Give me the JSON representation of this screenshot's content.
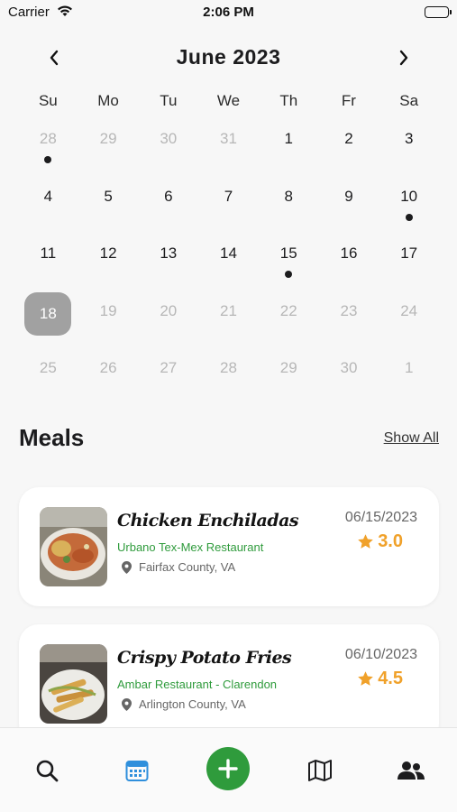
{
  "status_bar": {
    "carrier": "Carrier",
    "time": "2:06 PM"
  },
  "calendar": {
    "month_title": "June 2023",
    "weekdays": [
      "Su",
      "Mo",
      "Tu",
      "We",
      "Th",
      "Fr",
      "Sa"
    ],
    "weeks": [
      [
        {
          "d": "28",
          "m": true,
          "dot": true
        },
        {
          "d": "29",
          "m": true
        },
        {
          "d": "30",
          "m": true
        },
        {
          "d": "31",
          "m": true
        },
        {
          "d": "1"
        },
        {
          "d": "2"
        },
        {
          "d": "3"
        }
      ],
      [
        {
          "d": "4"
        },
        {
          "d": "5"
        },
        {
          "d": "6"
        },
        {
          "d": "7"
        },
        {
          "d": "8"
        },
        {
          "d": "9"
        },
        {
          "d": "10",
          "dot": true
        }
      ],
      [
        {
          "d": "11"
        },
        {
          "d": "12"
        },
        {
          "d": "13"
        },
        {
          "d": "14"
        },
        {
          "d": "15",
          "dot": true
        },
        {
          "d": "16"
        },
        {
          "d": "17"
        }
      ],
      [
        {
          "d": "18",
          "m": true,
          "sel": true
        },
        {
          "d": "19",
          "m": true
        },
        {
          "d": "20",
          "m": true
        },
        {
          "d": "21",
          "m": true
        },
        {
          "d": "22",
          "m": true
        },
        {
          "d": "23",
          "m": true
        },
        {
          "d": "24",
          "m": true
        }
      ],
      [
        {
          "d": "25",
          "m": true
        },
        {
          "d": "26",
          "m": true
        },
        {
          "d": "27",
          "m": true
        },
        {
          "d": "28",
          "m": true
        },
        {
          "d": "29",
          "m": true
        },
        {
          "d": "30",
          "m": true
        },
        {
          "d": "1",
          "m": true
        }
      ]
    ]
  },
  "meals": {
    "title": "Meals",
    "show_all": "Show All",
    "items": [
      {
        "name": "Chicken Enchiladas",
        "restaurant": "Urbano Tex-Mex Restaurant",
        "location": "Fairfax County, VA",
        "date": "06/15/2023",
        "rating": "3.0"
      },
      {
        "name": "Crispy Potato Fries",
        "restaurant": "Ambar Restaurant - Clarendon",
        "location": "Arlington County, VA",
        "date": "06/10/2023",
        "rating": "4.5"
      }
    ]
  },
  "tab_bar": {
    "icons": [
      "search-icon",
      "calendar-icon",
      "add-icon",
      "map-icon",
      "friends-icon"
    ],
    "active": "calendar-icon"
  },
  "colors": {
    "accent_green": "#2f9b3c",
    "star_orange": "#f0a12a",
    "active_tab_blue": "#2f8fdc",
    "selected_day_gray": "#a1a1a1"
  }
}
